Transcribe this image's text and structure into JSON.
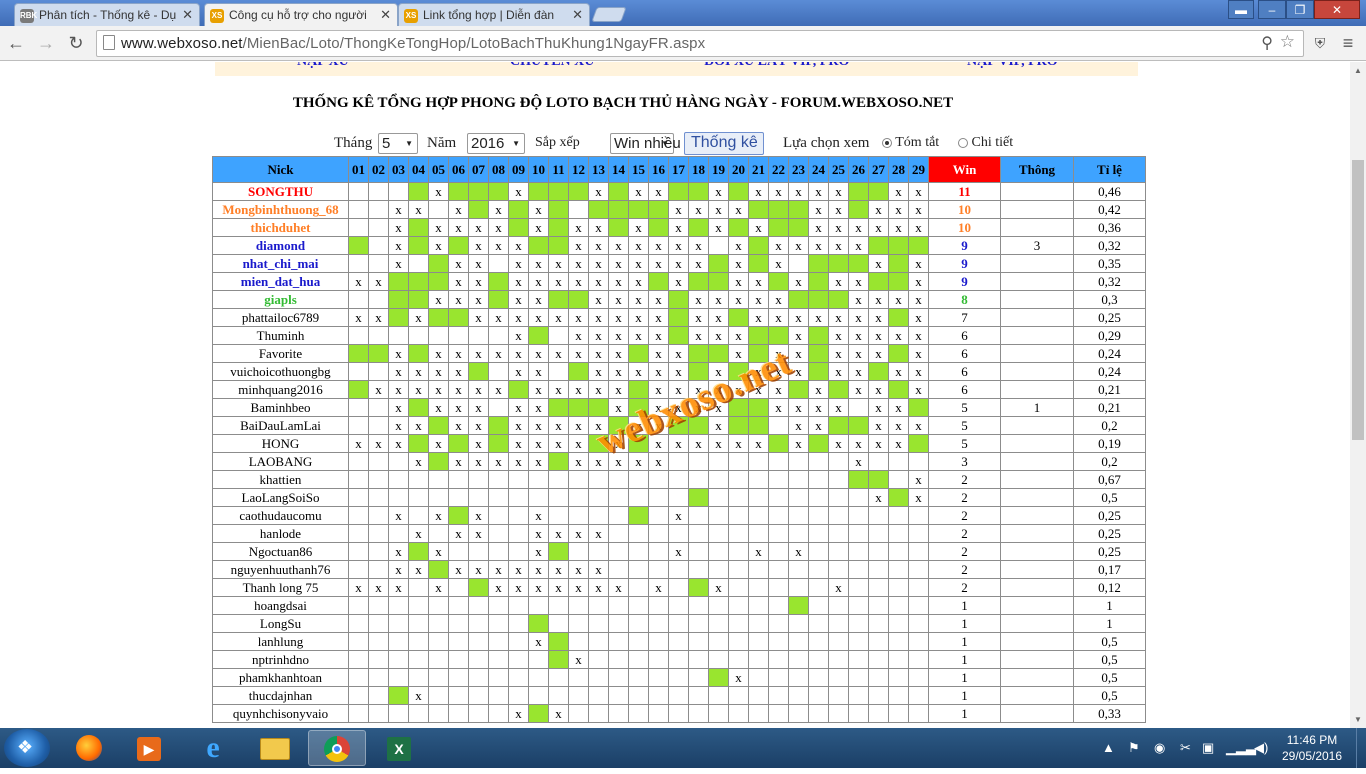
{
  "browser": {
    "tabs": [
      {
        "label": "Phân tích - Thống kê - Dụ",
        "favicon": "RBK"
      },
      {
        "label": "Công cụ hỗ trợ cho người",
        "favicon": "XS"
      },
      {
        "label": "Link tổng hợp | Diễn đàn",
        "favicon": "XS"
      }
    ],
    "url_host": "www.webxoso.net",
    "url_path": "/MienBac/Loto/ThongKeTongHop/LotoBachThuKhung1NgayFR.aspx"
  },
  "menu": [
    "NẠP XU",
    "CHUYỂN XU",
    "ĐỔI XU LẤY VIP, PRO",
    "NẠP VIP, PRO"
  ],
  "title": "THỐNG KÊ TỔNG HỢP PHONG ĐỘ LOTO BẠCH THỦ HÀNG NGÀY - FORUM.WEBXOSO.NET",
  "filters": {
    "month_label": "Tháng",
    "month_value": "5",
    "year_label": "Năm",
    "year_value": "2016",
    "sort_label": "Sắp xếp",
    "sort_value": "Win nhiều",
    "submit": "Thống kê",
    "view_label": "Lựa chọn xem",
    "opt_summary": "Tóm tắt",
    "opt_detail": "Chi tiết"
  },
  "table": {
    "headers": {
      "nick": "Nick",
      "win": "Win",
      "thong": "Thông",
      "tile": "Tỉ lệ"
    },
    "days": [
      "01",
      "02",
      "03",
      "04",
      "05",
      "06",
      "07",
      "08",
      "09",
      "10",
      "11",
      "12",
      "13",
      "14",
      "15",
      "16",
      "17",
      "18",
      "19",
      "20",
      "21",
      "22",
      "23",
      "24",
      "25",
      "26",
      "27",
      "28",
      "29"
    ],
    "rows": [
      {
        "nick": "SONGTHU",
        "color": "#ff0000",
        "cells": "...gxgggxgggxgxxggxgxxxxxggxx",
        "win": "11",
        "thong": "",
        "tile": "0,46"
      },
      {
        "nick": "Mongbinhthuong_68",
        "color": "#ff7f27",
        "cells": "..xx.xgxgxg.ggggxxxxgggxxgxxx",
        "win": "10",
        "thong": "",
        "tile": "0,42"
      },
      {
        "nick": "thichduhet",
        "color": "#ff7f27",
        "cells": "..xgxxxxgxgxxgxgxgxgxggxxxxxx",
        "win": "10",
        "thong": "",
        "tile": "0,36"
      },
      {
        "nick": "diamond",
        "color": "#1a1acc",
        "cells": "g.xgxgxxxggxxxxxxx.xgxxxxxggg",
        "win": "9",
        "thong": "3",
        "tile": "0,32"
      },
      {
        "nick": "nhat_chi_mai",
        "color": "#1a1acc",
        "cells": "..x.gxx.xxxxxxxxxxgxgx.gggxgx",
        "win": "9",
        "thong": "",
        "tile": "0,35"
      },
      {
        "nick": "mien_dat_hua",
        "color": "#1a1acc",
        "cells": "xxgggxxgxxxxxxxgxggxxgxgxxggx",
        "win": "9",
        "thong": "",
        "tile": "0,32"
      },
      {
        "nick": "giapls",
        "color": "#33bb33",
        "cells": "..ggxxxgxxggxxxxgxxxxxgggxxxx",
        "win": "8",
        "thong": "",
        "tile": "0,3"
      },
      {
        "nick": "phattailoc6789",
        "color": "#000",
        "cells": "xxgxggxxxxxxxxxxgxxgxxxxxxxgx",
        "win": "7",
        "thong": "",
        "tile": "0,25"
      },
      {
        "nick": "Thuminh",
        "color": "#000",
        "cells": "........xg.xxxxxgxxxggxgxxxxx",
        "win": "6",
        "thong": "",
        "tile": "0,29"
      },
      {
        "nick": "Favorite",
        "color": "#000",
        "cells": "ggxgxxxxxxxxxxgxxggxgxxgxxxgx",
        "win": "6",
        "thong": "",
        "tile": "0,24"
      },
      {
        "nick": "vuichoicothuongbg",
        "color": "#000",
        "cells": "..xxxxg.xx.gxxxxxgxgxxxgxxgxx",
        "win": "6",
        "thong": "",
        "tile": "0,24"
      },
      {
        "nick": "minhquang2016",
        "color": "#000",
        "cells": "gxxxxxxxgxxxxxgxxxxxxxgxgxxgx",
        "win": "6",
        "thong": "",
        "tile": "0,21"
      },
      {
        "nick": "Baminhbeo",
        "color": "#000",
        "cells": "..xgxxx.xxgggxgxxxxggxxxx.xxg",
        "win": "5",
        "thong": "1",
        "tile": "0,21"
      },
      {
        "nick": "BaiDauLamLai",
        "color": "#000",
        "cells": "..xxgxxgxxxxxgxxggxgg.xxggxxx",
        "win": "5",
        "thong": "",
        "tile": "0,2"
      },
      {
        "nick": "HONG",
        "color": "#000",
        "cells": "xxxgxgxgxxxxgxgxxxxxxgxgxxxxg",
        "win": "5",
        "thong": "",
        "tile": "0,19"
      },
      {
        "nick": "LAOBANG",
        "color": "#000",
        "cells": "...xgxxxxxgxxxxx.........x...",
        "win": "3",
        "thong": "",
        "tile": "0,2"
      },
      {
        "nick": "khattien",
        "color": "#000",
        "cells": ".........................gg.x",
        "win": "2",
        "thong": "",
        "tile": "0,67"
      },
      {
        "nick": "LaoLangSoiSo",
        "color": "#000",
        "cells": ".................g........xgx",
        "win": "2",
        "thong": "",
        "tile": "0,5"
      },
      {
        "nick": "caothudaucomu",
        "color": "#000",
        "cells": "..x.xgx..x....g.x............",
        "win": "2",
        "thong": "",
        "tile": "0,25"
      },
      {
        "nick": "hanlode",
        "color": "#000",
        "cells": "...x.xx..xxxx................",
        "win": "2",
        "thong": "",
        "tile": "0,25"
      },
      {
        "nick": "Ngoctuan86",
        "color": "#000",
        "cells": "..xgx....xg.....x...x.x......",
        "win": "2",
        "thong": "",
        "tile": "0,25"
      },
      {
        "nick": "nguyenhuuthanh76",
        "color": "#000",
        "cells": "..xxgxxxxxxxx................",
        "win": "2",
        "thong": "",
        "tile": "0,17"
      },
      {
        "nick": "Thanh long 75",
        "color": "#000",
        "cells": "xxx.x.gxxxxxxx.x.gx.....x....",
        "win": "2",
        "thong": "",
        "tile": "0,12"
      },
      {
        "nick": "hoangdsai",
        "color": "#000",
        "cells": "......................g......",
        "win": "1",
        "thong": "",
        "tile": "1"
      },
      {
        "nick": "LongSu",
        "color": "#000",
        "cells": ".........g...................",
        "win": "1",
        "thong": "",
        "tile": "1"
      },
      {
        "nick": "lanhlung",
        "color": "#000",
        "cells": ".........xg..................",
        "win": "1",
        "thong": "",
        "tile": "0,5"
      },
      {
        "nick": "nptrinhdno",
        "color": "#000",
        "cells": "..........gx.................",
        "win": "1",
        "thong": "",
        "tile": "0,5"
      },
      {
        "nick": "phamkhanhtoan",
        "color": "#000",
        "cells": "..................gx.........",
        "win": "1",
        "thong": "",
        "tile": "0,5"
      },
      {
        "nick": "thucdajnhan",
        "color": "#000",
        "cells": "..gx.........................",
        "win": "1",
        "thong": "",
        "tile": "0,5"
      },
      {
        "nick": "quynhchisonyvaio",
        "color": "#000",
        "cells": "........xgx..................",
        "win": "1",
        "thong": "",
        "tile": "0,33"
      }
    ]
  },
  "watermark": "webxoso.net",
  "taskbar": {
    "apps": [
      "firefox-icon",
      "media-player-icon",
      "ie-icon",
      "explorer-icon",
      "chrome-icon",
      "excel-icon"
    ],
    "time": "11:46 PM",
    "date": "29/05/2016"
  },
  "colors": {
    "green_cell": "#99e52f",
    "header_blue": "#3ea3ff",
    "win_header": "#ff0000"
  }
}
